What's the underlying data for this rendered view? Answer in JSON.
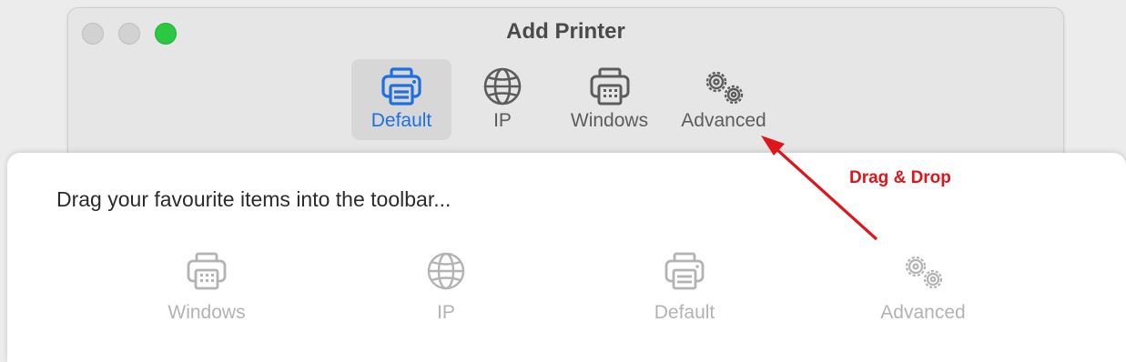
{
  "window": {
    "title": "Add Printer",
    "toolbar": [
      {
        "label": "Default",
        "icon": "printer-icon",
        "selected": true
      },
      {
        "label": "IP",
        "icon": "globe-icon",
        "selected": false
      },
      {
        "label": "Windows",
        "icon": "windows-printer-icon",
        "selected": false
      },
      {
        "label": "Advanced",
        "icon": "gears-icon",
        "selected": false
      }
    ]
  },
  "customize_sheet": {
    "title": "Drag your favourite items into the toolbar...",
    "palette": [
      {
        "label": "Windows",
        "icon": "windows-printer-icon"
      },
      {
        "label": "IP",
        "icon": "globe-icon"
      },
      {
        "label": "Default",
        "icon": "printer-icon"
      },
      {
        "label": "Advanced",
        "icon": "gears-icon"
      }
    ]
  },
  "annotation": {
    "text": "Drag & Drop",
    "color": "#e0151b"
  },
  "colors": {
    "accent": "#1e6fe0",
    "zoom_button": "#2bc841"
  }
}
